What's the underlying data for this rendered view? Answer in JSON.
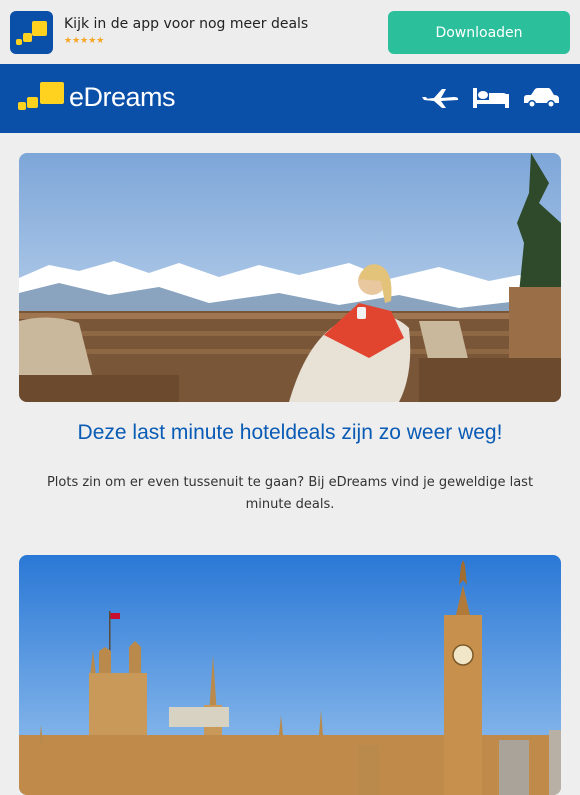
{
  "app_banner": {
    "text": "Kijk in de app voor nog meer deals",
    "rating": "★★★★★",
    "download_label": "Downloaden"
  },
  "header": {
    "brand": "eDreams",
    "nav": [
      "plane-icon",
      "bed-icon",
      "car-icon"
    ]
  },
  "main": {
    "headline": "Deze last minute hoteldeals zijn zo weer weg!",
    "intro": "Plots zin om er even tussenuit te gaan? Bij eDreams vind je geweldige last minute deals."
  },
  "colors": {
    "brand_blue": "#0a4fa8",
    "brand_yellow": "#ffd21f",
    "cta_green": "#2bbf9b",
    "headline_blue": "#0a5bb5"
  }
}
